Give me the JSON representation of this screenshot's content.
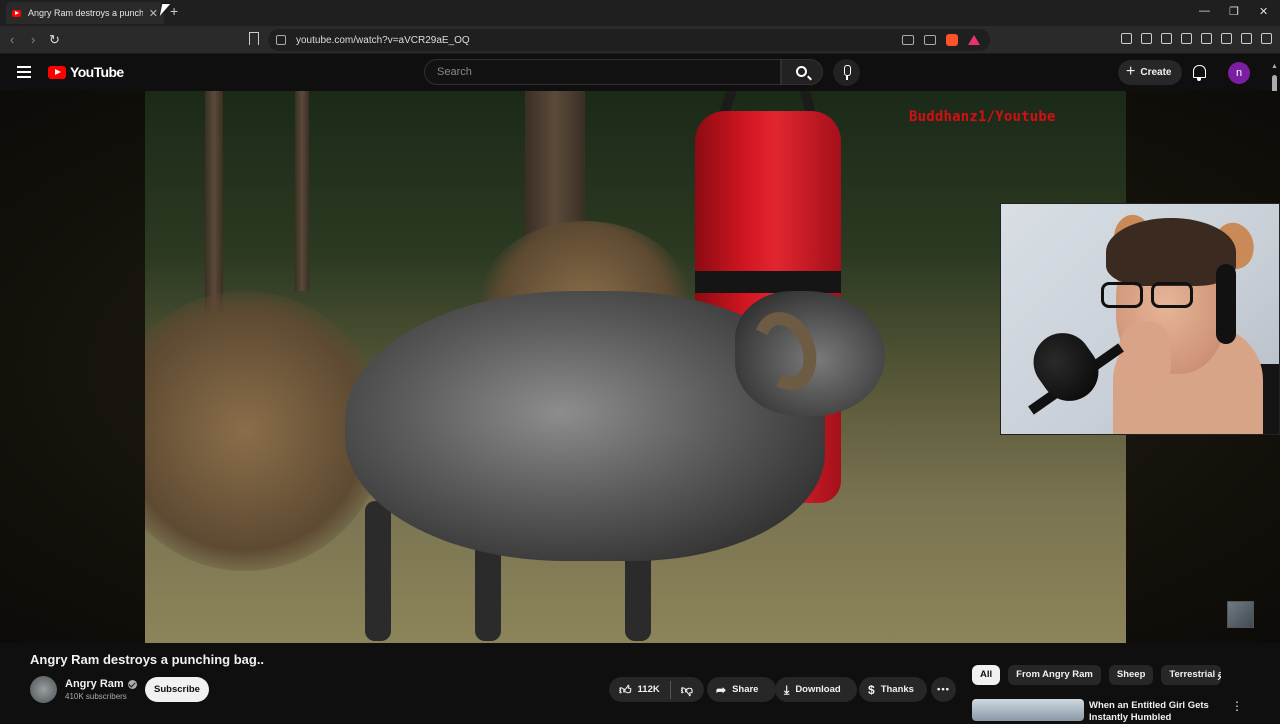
{
  "browser": {
    "tab_title": "Angry Ram destroys a punching",
    "url": "youtube.com/watch?v=aVCR29aE_OQ"
  },
  "youtube": {
    "logo_text": "YouTube",
    "search_placeholder": "Search",
    "create_label": "Create",
    "avatar_letter": "n"
  },
  "video": {
    "watermark": "Buddhanz1/Youtube",
    "title": "Angry Ram destroys a punching bag..",
    "channel": "Angry Ram",
    "subscribers": "410K subscribers",
    "subscribe_label": "Subscribe",
    "likes": "112K",
    "share_label": "Share",
    "download_label": "Download",
    "thanks_label": "Thanks"
  },
  "chips": [
    "All",
    "From Angry Ram",
    "Sheep",
    "Terrestrial a"
  ],
  "recommendation": {
    "title": "When an Entitled Girl Gets Instantly Humbled"
  },
  "icons": [
    "back-icon",
    "forward-icon",
    "reload-icon",
    "bookmark-icon",
    "search-icon",
    "mic-icon",
    "bell-icon",
    "like-icon",
    "dislike-icon",
    "share-icon",
    "download-icon",
    "thanks-icon",
    "more-icon",
    "chevron-right-icon"
  ]
}
